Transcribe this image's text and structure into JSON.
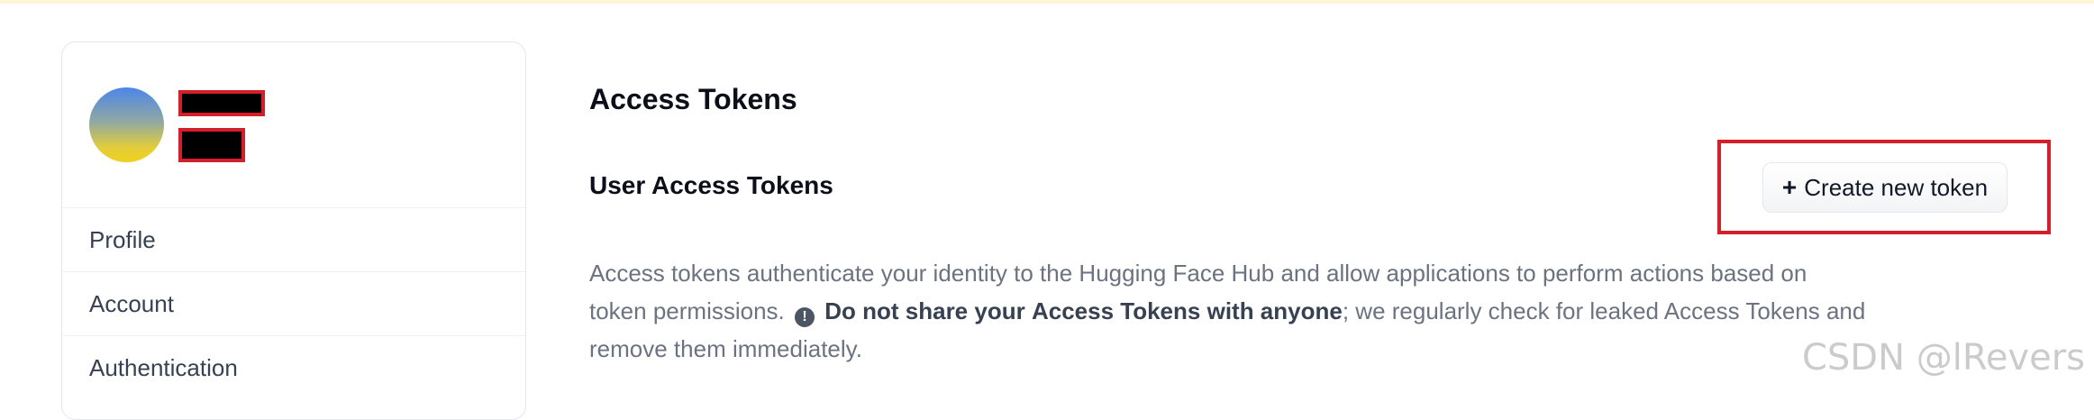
{
  "sidebar": {
    "items": [
      {
        "label": "Profile"
      },
      {
        "label": "Account"
      },
      {
        "label": "Authentication"
      }
    ]
  },
  "main": {
    "title": "Access Tokens",
    "section_title": "User Access Tokens",
    "create_button": {
      "icon": "+",
      "label": "Create new token"
    },
    "description": {
      "part1": "Access tokens authenticate your identity to the Hugging Face Hub and allow applications to perform actions based on token permissions.",
      "warning_icon": "!",
      "bold1": "Do not share your",
      "bold2": "Access Tokens",
      "bold3": "with anyone",
      "part2": "; we regularly check for leaked Access Tokens and remove them immediately."
    }
  },
  "watermark": "CSDN @lRevers",
  "colors": {
    "highlight": "#d21f2a",
    "top_strip": "#fdf6d8"
  }
}
